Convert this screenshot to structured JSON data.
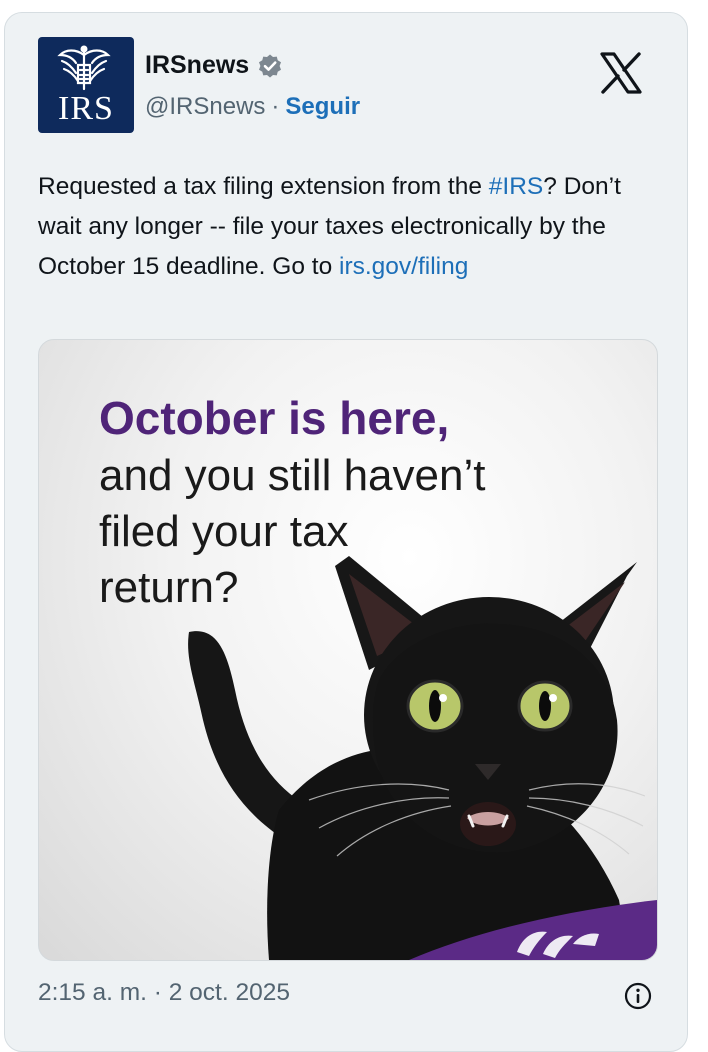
{
  "post": {
    "author": {
      "display_name": "IRSnews",
      "handle": "@IRSnews",
      "separator": "·",
      "follow_label": "Seguir",
      "avatar_text": "IRS",
      "verified": true
    },
    "platform_icon": "x-logo-icon",
    "text": {
      "part1": "Requested a tax filing extension from the ",
      "hashtag": "#IRS",
      "part2": "? Don’t wait any longer -- file your taxes electronically by the October 15 deadline. Go to ",
      "url": "irs.gov/filing"
    },
    "media": {
      "headline_highlight": "October is here,",
      "headline_rest": "and you still haven’t\nfiled your tax\nreturn?",
      "image_subject": "black-cat-surprised",
      "accent_color": "#5b2a86"
    },
    "timestamp": "2:15 a. m. · 2 oct. 2025",
    "info_icon": "info-icon"
  },
  "colors": {
    "link": "#1d6fb8",
    "card_bg": "#eef2f4",
    "avatar_bg": "#0e2a5c",
    "headline_purple": "#4f2478"
  }
}
